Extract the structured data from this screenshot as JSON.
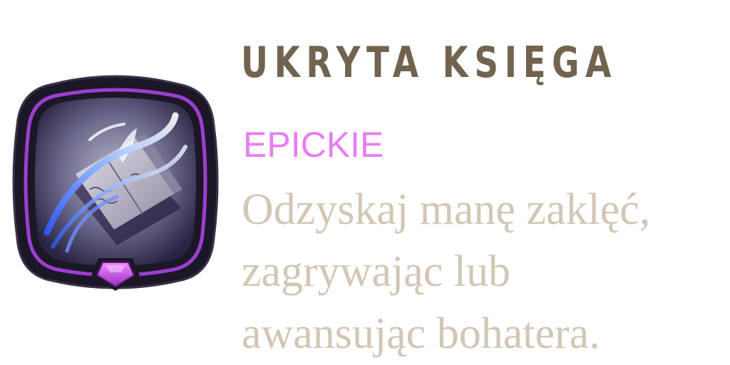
{
  "card": {
    "title": "UKRYTA KSIĘGA",
    "rarity": "EPICKIE",
    "description_lines": [
      "Odzyskaj manę zaklęć,",
      "zagrywając lub",
      "awansując bohatera."
    ],
    "icon": "spellbook-icon",
    "gem_icon": "pentagon-gem-icon"
  },
  "colors": {
    "title": "#72634f",
    "rarity": "#e67ff0",
    "description": "#d2c7b5",
    "frame_dark": "#1c1726",
    "frame_purple": "#9b3fd0",
    "frame_gold": "#b79d72",
    "gem": "#c24be6"
  }
}
